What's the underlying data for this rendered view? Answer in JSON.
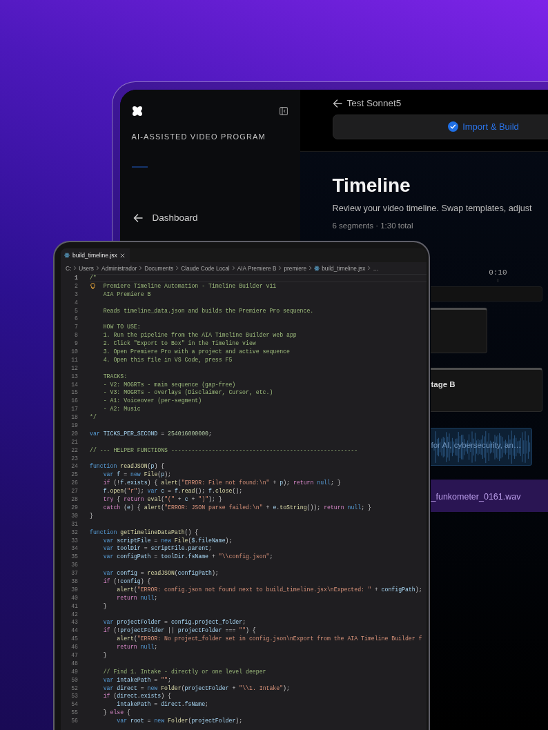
{
  "app_window": {
    "sidebar": {
      "heading": "AI-ASSISTED VIDEO PROGRAM",
      "nav_items": [
        {
          "label": "Dashboard"
        }
      ]
    },
    "header": {
      "back_label": "Test Sonnet5",
      "button": {
        "label": "Import & Build"
      }
    },
    "page": {
      "title": "Timeline",
      "description": "Review your video timeline. Swap templates, adjust",
      "summary": "6 segments · 1:30 total"
    },
    "timeline": {
      "ruler_labels": [
        "0:10"
      ],
      "tracks": [
        {
          "kind": "bar"
        },
        {
          "kind": "video"
        },
        {
          "kind": "video",
          "label": "tage B"
        },
        {
          "kind": "audio",
          "label": "for AI, cybersecurity, an…"
        },
        {
          "kind": "music",
          "label": "_funkometer_0161.wav"
        }
      ]
    }
  },
  "editor_window": {
    "tabs": [
      {
        "label": "build_timeline.jsx",
        "selected": true
      }
    ],
    "breadcrumb": [
      {
        "kind": "dir",
        "label": "C:"
      },
      {
        "kind": "dir",
        "label": "Users"
      },
      {
        "kind": "dir",
        "label": "Administrador"
      },
      {
        "kind": "dir",
        "label": "Documents"
      },
      {
        "kind": "dir",
        "label": "Claude Code Local"
      },
      {
        "kind": "dir",
        "label": "AIA Premiere B"
      },
      {
        "kind": "dir",
        "label": "premiere"
      },
      {
        "kind": "file",
        "label": "build_timeline.jsx"
      },
      {
        "kind": "more",
        "label": "…"
      }
    ],
    "lines": [
      {
        "number": "1",
        "current": true,
        "tokens": [
          {
            "kind": "c",
            "text": "/*"
          }
        ]
      },
      {
        "number": "2",
        "current": false,
        "lightbulb": true,
        "tokens": [
          {
            "kind": "c",
            "text": "    Premiere Timeline Automation - Timeline Builder v11"
          }
        ]
      },
      {
        "number": "3",
        "current": false,
        "tokens": [
          {
            "kind": "c",
            "text": "    AIA Premiere B"
          }
        ]
      },
      {
        "number": "4",
        "current": false
      },
      {
        "number": "5",
        "current": false,
        "tokens": [
          {
            "kind": "c",
            "text": "    Reads timeline_data.json and builds the Premiere Pro sequence."
          }
        ]
      },
      {
        "number": "6",
        "current": false
      },
      {
        "number": "7",
        "current": false,
        "tokens": [
          {
            "kind": "c",
            "text": "    HOW TO USE:"
          }
        ]
      },
      {
        "number": "8",
        "current": false,
        "tokens": [
          {
            "kind": "c",
            "text": "    1. Run the pipeline from the AIA Timeline Builder web app"
          }
        ]
      },
      {
        "number": "9",
        "current": false,
        "tokens": [
          {
            "kind": "c",
            "text": "    2. Click \"Export to Box\" in the Timeline view"
          }
        ]
      },
      {
        "number": "10",
        "current": false,
        "tokens": [
          {
            "kind": "c",
            "text": "    3. Open Premiere Pro with a project and active sequence"
          }
        ]
      },
      {
        "number": "11",
        "current": false,
        "tokens": [
          {
            "kind": "c",
            "text": "    4. Open this file in VS Code, press F5"
          }
        ]
      },
      {
        "number": "12",
        "current": false
      },
      {
        "number": "13",
        "current": false,
        "tokens": [
          {
            "kind": "c",
            "text": "    TRACKS:"
          }
        ]
      },
      {
        "number": "14",
        "current": false,
        "tokens": [
          {
            "kind": "c",
            "text": "    - V2: MOGRTs - main sequence (gap-free)"
          }
        ]
      },
      {
        "number": "15",
        "current": false,
        "tokens": [
          {
            "kind": "c",
            "text": "    - V3: MOGRTs - overlays (Disclaimer, Cursor, etc.)"
          }
        ]
      },
      {
        "number": "16",
        "current": false,
        "tokens": [
          {
            "kind": "c",
            "text": "    - A1: Voiceover (per-segment)"
          }
        ]
      },
      {
        "number": "17",
        "current": false,
        "tokens": [
          {
            "kind": "c",
            "text": "    - A2: Music"
          }
        ]
      },
      {
        "number": "18",
        "current": false,
        "tokens": [
          {
            "kind": "c",
            "text": "*/"
          }
        ]
      },
      {
        "number": "19",
        "current": false
      },
      {
        "number": "20",
        "current": false,
        "tokens": [
          {
            "kind": "k",
            "text": "var "
          },
          {
            "kind": "v",
            "text": "TICKS_PER_SECOND"
          },
          {
            "kind": "p",
            "text": " = "
          },
          {
            "kind": "n",
            "text": "254016000000"
          },
          {
            "kind": "p",
            "text": ";"
          }
        ]
      },
      {
        "number": "21",
        "current": false
      },
      {
        "number": "22",
        "current": false,
        "tokens": [
          {
            "kind": "c",
            "text": "// --- HELPER FUNCTIONS -------------------------------------------------------"
          }
        ]
      },
      {
        "number": "23",
        "current": false
      },
      {
        "number": "24",
        "current": false,
        "tokens": [
          {
            "kind": "k",
            "text": "function "
          },
          {
            "kind": "f",
            "text": "readJSON"
          },
          {
            "kind": "p",
            "text": "("
          },
          {
            "kind": "v",
            "text": "p"
          },
          {
            "kind": "p",
            "text": ") {"
          }
        ]
      },
      {
        "number": "25",
        "current": false,
        "tokens": [
          {
            "kind": "k",
            "text": "    var "
          },
          {
            "kind": "v",
            "text": "f"
          },
          {
            "kind": "p",
            "text": " = "
          },
          {
            "kind": "k",
            "text": "new "
          },
          {
            "kind": "f",
            "text": "File"
          },
          {
            "kind": "p",
            "text": "("
          },
          {
            "kind": "v",
            "text": "p"
          },
          {
            "kind": "p",
            "text": ");"
          }
        ]
      },
      {
        "number": "26",
        "current": false,
        "tokens": [
          {
            "kind": "x",
            "text": "    if"
          },
          {
            "kind": "p",
            "text": " (!"
          },
          {
            "kind": "v",
            "text": "f"
          },
          {
            "kind": "p",
            "text": "."
          },
          {
            "kind": "v",
            "text": "exists"
          },
          {
            "kind": "p",
            "text": ") { "
          },
          {
            "kind": "f",
            "text": "alert"
          },
          {
            "kind": "p",
            "text": "("
          },
          {
            "kind": "s",
            "text": "\"ERROR: File not found:\\n\""
          },
          {
            "kind": "p",
            "text": " + "
          },
          {
            "kind": "v",
            "text": "p"
          },
          {
            "kind": "p",
            "text": "); "
          },
          {
            "kind": "x",
            "text": "return "
          },
          {
            "kind": "k",
            "text": "null"
          },
          {
            "kind": "p",
            "text": "; }"
          }
        ]
      },
      {
        "number": "27",
        "current": false,
        "tokens": [
          {
            "kind": "v",
            "text": "    f"
          },
          {
            "kind": "p",
            "text": "."
          },
          {
            "kind": "f",
            "text": "open"
          },
          {
            "kind": "p",
            "text": "("
          },
          {
            "kind": "s",
            "text": "\"r\""
          },
          {
            "kind": "p",
            "text": "); "
          },
          {
            "kind": "k",
            "text": "var "
          },
          {
            "kind": "v",
            "text": "c"
          },
          {
            "kind": "p",
            "text": " = "
          },
          {
            "kind": "v",
            "text": "f"
          },
          {
            "kind": "p",
            "text": "."
          },
          {
            "kind": "f",
            "text": "read"
          },
          {
            "kind": "p",
            "text": "(); "
          },
          {
            "kind": "v",
            "text": "f"
          },
          {
            "kind": "p",
            "text": "."
          },
          {
            "kind": "f",
            "text": "close"
          },
          {
            "kind": "p",
            "text": "();"
          }
        ]
      },
      {
        "number": "28",
        "current": false,
        "tokens": [
          {
            "kind": "x",
            "text": "    try"
          },
          {
            "kind": "p",
            "text": " { "
          },
          {
            "kind": "x",
            "text": "return "
          },
          {
            "kind": "f",
            "text": "eval"
          },
          {
            "kind": "p",
            "text": "("
          },
          {
            "kind": "s",
            "text": "\"(\""
          },
          {
            "kind": "p",
            "text": " + "
          },
          {
            "kind": "v",
            "text": "c"
          },
          {
            "kind": "p",
            "text": " + "
          },
          {
            "kind": "s",
            "text": "\")\""
          },
          {
            "kind": "p",
            "text": "); }"
          }
        ]
      },
      {
        "number": "29",
        "current": false,
        "tokens": [
          {
            "kind": "x",
            "text": "    catch"
          },
          {
            "kind": "p",
            "text": " ("
          },
          {
            "kind": "v",
            "text": "e"
          },
          {
            "kind": "p",
            "text": ") { "
          },
          {
            "kind": "f",
            "text": "alert"
          },
          {
            "kind": "p",
            "text": "("
          },
          {
            "kind": "s",
            "text": "\"ERROR: JSON parse failed:\\n\""
          },
          {
            "kind": "p",
            "text": " + "
          },
          {
            "kind": "v",
            "text": "e"
          },
          {
            "kind": "p",
            "text": "."
          },
          {
            "kind": "f",
            "text": "toString"
          },
          {
            "kind": "p",
            "text": "()); "
          },
          {
            "kind": "x",
            "text": "return "
          },
          {
            "kind": "k",
            "text": "null"
          },
          {
            "kind": "p",
            "text": "; }"
          }
        ]
      },
      {
        "number": "30",
        "current": false,
        "tokens": [
          {
            "kind": "p",
            "text": "}"
          }
        ]
      },
      {
        "number": "31",
        "current": false
      },
      {
        "number": "32",
        "current": false,
        "tokens": [
          {
            "kind": "k",
            "text": "function "
          },
          {
            "kind": "f",
            "text": "getTimelineDataPath"
          },
          {
            "kind": "p",
            "text": "() {"
          }
        ]
      },
      {
        "number": "33",
        "current": false,
        "tokens": [
          {
            "kind": "k",
            "text": "    var "
          },
          {
            "kind": "v",
            "text": "scriptFile"
          },
          {
            "kind": "p",
            "text": " = "
          },
          {
            "kind": "k",
            "text": "new "
          },
          {
            "kind": "f",
            "text": "File"
          },
          {
            "kind": "p",
            "text": "("
          },
          {
            "kind": "v",
            "text": "$"
          },
          {
            "kind": "p",
            "text": "."
          },
          {
            "kind": "v",
            "text": "fileName"
          },
          {
            "kind": "p",
            "text": ");"
          }
        ]
      },
      {
        "number": "34",
        "current": false,
        "tokens": [
          {
            "kind": "k",
            "text": "    var "
          },
          {
            "kind": "v",
            "text": "toolDir"
          },
          {
            "kind": "p",
            "text": " = "
          },
          {
            "kind": "v",
            "text": "scriptFile"
          },
          {
            "kind": "p",
            "text": "."
          },
          {
            "kind": "v",
            "text": "parent"
          },
          {
            "kind": "p",
            "text": ";"
          }
        ]
      },
      {
        "number": "35",
        "current": false,
        "tokens": [
          {
            "kind": "k",
            "text": "    var "
          },
          {
            "kind": "v",
            "text": "configPath"
          },
          {
            "kind": "p",
            "text": " = "
          },
          {
            "kind": "v",
            "text": "toolDir"
          },
          {
            "kind": "p",
            "text": "."
          },
          {
            "kind": "v",
            "text": "fsName"
          },
          {
            "kind": "p",
            "text": " + "
          },
          {
            "kind": "s",
            "text": "\"\\\\config.json\""
          },
          {
            "kind": "p",
            "text": ";"
          }
        ]
      },
      {
        "number": "36",
        "current": false
      },
      {
        "number": "37",
        "current": false,
        "tokens": [
          {
            "kind": "k",
            "text": "    var "
          },
          {
            "kind": "v",
            "text": "config"
          },
          {
            "kind": "p",
            "text": " = "
          },
          {
            "kind": "f",
            "text": "readJSON"
          },
          {
            "kind": "p",
            "text": "("
          },
          {
            "kind": "v",
            "text": "configPath"
          },
          {
            "kind": "p",
            "text": ");"
          }
        ]
      },
      {
        "number": "38",
        "current": false,
        "tokens": [
          {
            "kind": "x",
            "text": "    if"
          },
          {
            "kind": "p",
            "text": " (!"
          },
          {
            "kind": "v",
            "text": "config"
          },
          {
            "kind": "p",
            "text": ") {"
          }
        ]
      },
      {
        "number": "39",
        "current": false,
        "tokens": [
          {
            "kind": "f",
            "text": "        alert"
          },
          {
            "kind": "p",
            "text": "("
          },
          {
            "kind": "s",
            "text": "\"ERROR: config.json not found next to build_timeline.jsx\\nExpected: \""
          },
          {
            "kind": "p",
            "text": " + "
          },
          {
            "kind": "v",
            "text": "configPath"
          },
          {
            "kind": "p",
            "text": ");"
          }
        ]
      },
      {
        "number": "40",
        "current": false,
        "tokens": [
          {
            "kind": "x",
            "text": "        return "
          },
          {
            "kind": "k",
            "text": "null"
          },
          {
            "kind": "p",
            "text": ";"
          }
        ]
      },
      {
        "number": "41",
        "current": false,
        "tokens": [
          {
            "kind": "p",
            "text": "    }"
          }
        ]
      },
      {
        "number": "42",
        "current": false
      },
      {
        "number": "43",
        "current": false,
        "tokens": [
          {
            "kind": "k",
            "text": "    var "
          },
          {
            "kind": "v",
            "text": "projectFolder"
          },
          {
            "kind": "p",
            "text": " = "
          },
          {
            "kind": "v",
            "text": "config"
          },
          {
            "kind": "p",
            "text": "."
          },
          {
            "kind": "v",
            "text": "project_folder"
          },
          {
            "kind": "p",
            "text": ";"
          }
        ]
      },
      {
        "number": "44",
        "current": false,
        "tokens": [
          {
            "kind": "x",
            "text": "    if"
          },
          {
            "kind": "p",
            "text": " (!"
          },
          {
            "kind": "v",
            "text": "projectFolder"
          },
          {
            "kind": "p",
            "text": " || "
          },
          {
            "kind": "v",
            "text": "projectFolder"
          },
          {
            "kind": "p",
            "text": " === "
          },
          {
            "kind": "s",
            "text": "\"\""
          },
          {
            "kind": "p",
            "text": ") {"
          }
        ]
      },
      {
        "number": "45",
        "current": false,
        "tokens": [
          {
            "kind": "f",
            "text": "        alert"
          },
          {
            "kind": "p",
            "text": "("
          },
          {
            "kind": "s",
            "text": "\"ERROR: No project_folder set in config.json\\nExport from the AIA Timeline Builder f"
          }
        ]
      },
      {
        "number": "46",
        "current": false,
        "tokens": [
          {
            "kind": "x",
            "text": "        return "
          },
          {
            "kind": "k",
            "text": "null"
          },
          {
            "kind": "p",
            "text": ";"
          }
        ]
      },
      {
        "number": "47",
        "current": false,
        "tokens": [
          {
            "kind": "p",
            "text": "    }"
          }
        ]
      },
      {
        "number": "48",
        "current": false
      },
      {
        "number": "49",
        "current": false,
        "tokens": [
          {
            "kind": "c",
            "text": "    // Find 1. Intake - directly or one level deeper"
          }
        ]
      },
      {
        "number": "50",
        "current": false,
        "tokens": [
          {
            "kind": "k",
            "text": "    var "
          },
          {
            "kind": "v",
            "text": "intakePath"
          },
          {
            "kind": "p",
            "text": " = "
          },
          {
            "kind": "s",
            "text": "\"\""
          },
          {
            "kind": "p",
            "text": ";"
          }
        ]
      },
      {
        "number": "52",
        "current": false,
        "tokens": [
          {
            "kind": "k",
            "text": "    var "
          },
          {
            "kind": "v",
            "text": "direct"
          },
          {
            "kind": "p",
            "text": " = "
          },
          {
            "kind": "k",
            "text": "new "
          },
          {
            "kind": "f",
            "text": "Folder"
          },
          {
            "kind": "p",
            "text": "("
          },
          {
            "kind": "v",
            "text": "projectFolder"
          },
          {
            "kind": "p",
            "text": " + "
          },
          {
            "kind": "s",
            "text": "\"\\\\1. Intake\""
          },
          {
            "kind": "p",
            "text": ");"
          }
        ]
      },
      {
        "number": "53",
        "current": false,
        "tokens": [
          {
            "kind": "x",
            "text": "    if"
          },
          {
            "kind": "p",
            "text": " ("
          },
          {
            "kind": "v",
            "text": "direct"
          },
          {
            "kind": "p",
            "text": "."
          },
          {
            "kind": "v",
            "text": "exists"
          },
          {
            "kind": "p",
            "text": ") {"
          }
        ]
      },
      {
        "number": "54",
        "current": false,
        "tokens": [
          {
            "kind": "v",
            "text": "        intakePath"
          },
          {
            "kind": "p",
            "text": " = "
          },
          {
            "kind": "v",
            "text": "direct"
          },
          {
            "kind": "p",
            "text": "."
          },
          {
            "kind": "v",
            "text": "fsName"
          },
          {
            "kind": "p",
            "text": ";"
          }
        ]
      },
      {
        "number": "55",
        "current": false,
        "tokens": [
          {
            "kind": "p",
            "text": "    } "
          },
          {
            "kind": "x",
            "text": "else"
          },
          {
            "kind": "p",
            "text": " {"
          }
        ]
      },
      {
        "number": "56",
        "current": false,
        "tokens": [
          {
            "kind": "k",
            "text": "        var "
          },
          {
            "kind": "v",
            "text": "root"
          },
          {
            "kind": "p",
            "text": " = "
          },
          {
            "kind": "k",
            "text": "new "
          },
          {
            "kind": "f",
            "text": "Folder"
          },
          {
            "kind": "p",
            "text": "("
          },
          {
            "kind": "v",
            "text": "projectFolder"
          },
          {
            "kind": "p",
            "text": ");"
          }
        ]
      }
    ]
  }
}
